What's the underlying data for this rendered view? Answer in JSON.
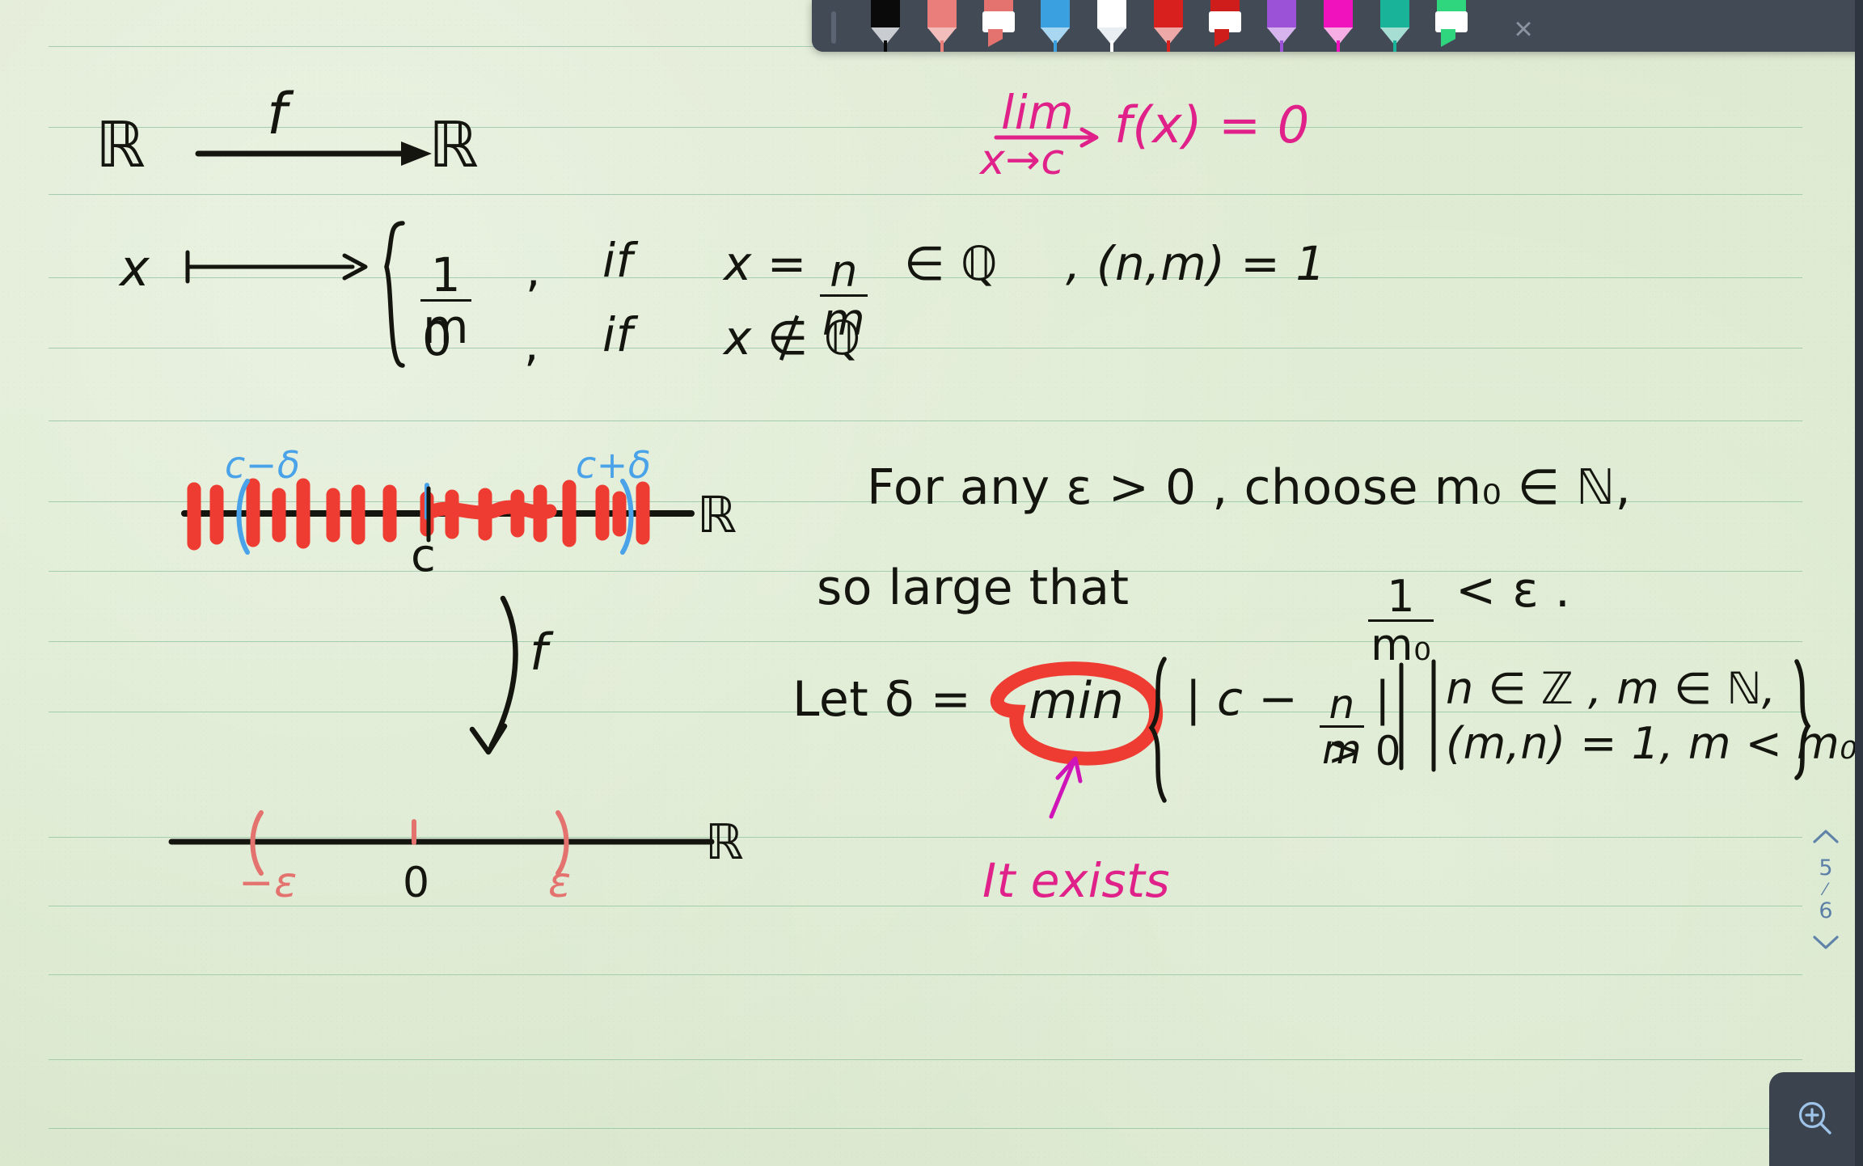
{
  "app": {
    "background_color": "#dfe9d4",
    "rule_color": "#8fc0a0",
    "toolbar_bg": "#424a56"
  },
  "toolbar": {
    "close_label": "×",
    "pens": [
      {
        "name": "pen-black",
        "type": "pen",
        "color": "#0a0a0a",
        "barrel": "#0a0a0a",
        "tip": "#c9ccd1"
      },
      {
        "name": "pen-salmon",
        "type": "pen",
        "color": "#e97e7b",
        "barrel": "#e97e7b",
        "tip": "#f3bdbb"
      },
      {
        "name": "highlighter-salmon",
        "type": "highlighter",
        "color": "#e4736f",
        "barrel": "#a0605e",
        "tip": "#e4736f"
      },
      {
        "name": "pen-blue",
        "type": "pen",
        "color": "#3aa0e0",
        "barrel": "#3aa0e0",
        "tip": "#a9d6f1"
      },
      {
        "name": "pen-white",
        "type": "pen",
        "color": "#ffffff",
        "barrel": "#ffffff",
        "tip": "#e8eef2"
      },
      {
        "name": "pen-red",
        "type": "pen",
        "color": "#d8201f",
        "barrel": "#d8201f",
        "tip": "#eda9a7"
      },
      {
        "name": "highlighter-red",
        "type": "highlighter",
        "color": "#cf1d1c",
        "barrel": "#8e3b38",
        "tip": "#cf1d1c"
      },
      {
        "name": "pen-purple",
        "type": "pen",
        "color": "#9b52d6",
        "barrel": "#9b52d6",
        "tip": "#d7b4ed"
      },
      {
        "name": "pen-magenta",
        "type": "pen",
        "color": "#ef12bd",
        "barrel": "#ef12bd",
        "tip": "#f6aee5"
      },
      {
        "name": "pen-teal",
        "type": "pen",
        "color": "#19b39a",
        "barrel": "#19b39a",
        "tip": "#a7ded4"
      },
      {
        "name": "highlighter-green",
        "type": "highlighter",
        "color": "#2fd67e",
        "barrel": "#3f8f66",
        "tip": "#2fd67e"
      }
    ]
  },
  "page_nav": {
    "up_icon": "⌃",
    "down_icon": "⌄",
    "current_page": "5",
    "separator": "⁄",
    "total_pages": "6"
  },
  "zoom_control": {
    "icon": "zoom-in-icon",
    "label": "Zoom in"
  },
  "notes": {
    "line1": {
      "domain": "ℝ",
      "map_label": "f",
      "codomain": "ℝ"
    },
    "limit_note": {
      "lim": "lim",
      "subscript": "x→c",
      "body": "f(x) = 0",
      "color": "#e0218a"
    },
    "definition": {
      "variable": "x",
      "arrow": "⟼",
      "case1_value_num": "1",
      "case1_value_den": "m",
      "case1_sep": ",",
      "case1_if": "if",
      "case1_cond_lhs": "x =",
      "case1_cond_num": "n",
      "case1_cond_den": "m",
      "case1_cond_rhs": "∈ ℚ",
      "case1_extra": ", (n,m) = 1",
      "case2_value": "0",
      "case2_sep": ",",
      "case2_if": "if",
      "case2_cond": "x ∉ ℚ"
    },
    "top_number_line": {
      "left_label": "c−δ",
      "right_label": "c+δ",
      "center_label": "c",
      "axis_label": "ℝ",
      "tick_color": "#ef3c32",
      "bracket_color": "#4aa3e8"
    },
    "map_arrow_label": "f",
    "bottom_number_line": {
      "left_label": "−ε",
      "center_label": "0",
      "right_label": "ε",
      "axis_label": "ℝ",
      "bracket_color": "#e4736f"
    },
    "proof": {
      "line1": "For any ε > 0 , choose m₀ ∈ ℕ,",
      "line2_a": "so large that",
      "line2_frac_num": "1",
      "line2_frac_den": "m₀",
      "line2_b": "< ε .",
      "line3_a": "Let δ =",
      "line3_min": "min",
      "line3_open": "{",
      "line3_abs_a": "| c −",
      "line3_frac_num": "n",
      "line3_frac_den": "m",
      "line3_abs_b": "|",
      "line3_gt": "> 0",
      "line3_cond_top": "n ∈ ℤ , m ∈ ℕ,",
      "line3_cond_bottom": "(m,n) = 1, m < m₀",
      "line3_close": "}",
      "annotation": "It exists",
      "annotation_color": "#e0218a",
      "circle_color": "#ef3c32"
    }
  }
}
